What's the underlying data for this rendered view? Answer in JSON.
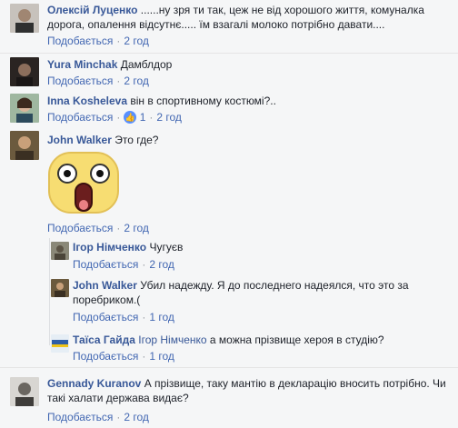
{
  "colors": {
    "link": "#4267b2",
    "name": "#385898",
    "meta": "#90949c",
    "like_badge": "#5890ff"
  },
  "like_label": "Подобається",
  "comments": [
    {
      "author": "Олексій Луценко",
      "text": "......ну зря ти так, цеж не від хорошого життя, комуналка дорога, опалення відсутнє..... їм взагалі молоко потрібно давати....",
      "time": "2 год"
    },
    {
      "author": "Yura Minchak",
      "text": "Дамблдор",
      "time": "2 год"
    },
    {
      "author": "Inna Kosheleva",
      "text": "він в спортивному костюмі?..",
      "likes": "1",
      "time": "2 год"
    },
    {
      "author": "John Walker",
      "text": "Это где?",
      "sticker": "shocked-face-sticker",
      "time": "2 год"
    }
  ],
  "replies": [
    {
      "author": "Ігор Німченко",
      "text": "Чугуєв",
      "time": "2 год"
    },
    {
      "author": "John Walker",
      "text": "Убил надежду. Я до последнего надеялся, что это за поребриком.(",
      "time": "1 год"
    },
    {
      "author": "Таїса Гайда",
      "mention": "Ігор Німченко",
      "text": "а можна прізвище хероя в студію?",
      "time": "1 год"
    }
  ],
  "last_comment": {
    "author": "Gennady Kuranov",
    "text": "А прізвище, таку мантію в декларацію вносить потрібно. Чи такі халати держава видає?",
    "time": "2 год"
  }
}
